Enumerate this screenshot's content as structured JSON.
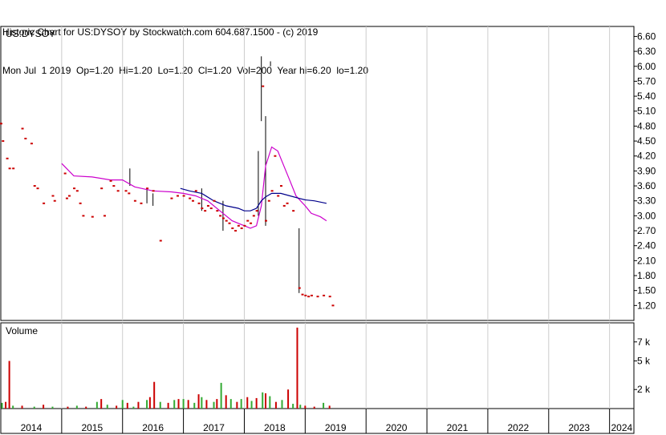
{
  "header": {
    "line1": "Historic Chart for US:DYSOY by Stockwatch.com 604.687.1500 - (c) 2019",
    "line2": "Mon Jul  1 2019  Op=1.20  Hi=1.20  Lo=1.20  Cl=1.20  Vol=200  Year hi=6.20  lo=1.20"
  },
  "colors": {
    "ma_short": "#cc00cc",
    "ma_long": "#00008b",
    "price": "#cc0000",
    "vol_up": "#33aa33",
    "vol_down": "#cc0000"
  },
  "chart_data": {
    "type": "line",
    "title": "US:DYSOY",
    "price_axis": {
      "ylim": [
        0.9,
        6.8
      ],
      "ticks": [
        "6.60",
        "6.30",
        "6.00",
        "5.70",
        "5.40",
        "5.10",
        "4.80",
        "4.50",
        "4.20",
        "3.90",
        "3.60",
        "3.30",
        "3.00",
        "2.70",
        "2.40",
        "2.10",
        "1.80",
        "1.50",
        "1.20"
      ]
    },
    "volume_panel": {
      "label": "Volume",
      "ylim": [
        0,
        9000
      ],
      "ticks": [
        {
          "v": 7000,
          "label": "7 k"
        },
        {
          "v": 5000,
          "label": "5 k"
        },
        {
          "v": 2000,
          "label": "2 k"
        }
      ]
    },
    "x_axis": {
      "years": [
        "2014",
        "2015",
        "2016",
        "2017",
        "2018",
        "2019",
        "2020",
        "2021",
        "2022",
        "2023",
        "2024"
      ],
      "xlim": [
        2014.0,
        2024.4
      ]
    },
    "price_points": [
      [
        2014.0,
        4.85
      ],
      [
        2014.03,
        4.5
      ],
      [
        2014.1,
        4.15
      ],
      [
        2014.14,
        3.95
      ],
      [
        2014.2,
        3.95
      ],
      [
        2014.35,
        4.75
      ],
      [
        2014.4,
        4.55
      ],
      [
        2014.5,
        4.45
      ],
      [
        2014.55,
        3.6
      ],
      [
        2014.6,
        3.55
      ],
      [
        2014.7,
        3.25
      ],
      [
        2014.85,
        3.4
      ],
      [
        2014.88,
        3.3
      ],
      [
        2015.05,
        3.85
      ],
      [
        2015.08,
        3.35
      ],
      [
        2015.12,
        3.4
      ],
      [
        2015.2,
        3.55
      ],
      [
        2015.25,
        3.5
      ],
      [
        2015.3,
        3.25
      ],
      [
        2015.35,
        3.0
      ],
      [
        2015.5,
        2.98
      ],
      [
        2015.65,
        3.55
      ],
      [
        2015.7,
        3.0
      ],
      [
        2015.8,
        3.7
      ],
      [
        2015.85,
        3.6
      ],
      [
        2015.92,
        3.5
      ],
      [
        2016.05,
        3.5
      ],
      [
        2016.1,
        3.45
      ],
      [
        2016.2,
        3.3
      ],
      [
        2016.3,
        3.25
      ],
      [
        2016.4,
        3.55
      ],
      [
        2016.5,
        3.5
      ],
      [
        2016.62,
        2.5
      ],
      [
        2016.8,
        3.35
      ],
      [
        2016.9,
        3.4
      ],
      [
        2017.0,
        3.4
      ],
      [
        2017.1,
        3.35
      ],
      [
        2017.15,
        3.3
      ],
      [
        2017.2,
        3.5
      ],
      [
        2017.25,
        3.25
      ],
      [
        2017.3,
        3.15
      ],
      [
        2017.35,
        3.1
      ],
      [
        2017.4,
        3.2
      ],
      [
        2017.45,
        3.15
      ],
      [
        2017.5,
        3.3
      ],
      [
        2017.55,
        3.1
      ],
      [
        2017.6,
        3.0
      ],
      [
        2017.65,
        2.95
      ],
      [
        2017.7,
        2.9
      ],
      [
        2017.75,
        2.85
      ],
      [
        2017.8,
        2.75
      ],
      [
        2017.85,
        2.7
      ],
      [
        2017.9,
        2.8
      ],
      [
        2017.95,
        2.75
      ],
      [
        2018.0,
        2.8
      ],
      [
        2018.05,
        2.9
      ],
      [
        2018.1,
        2.85
      ],
      [
        2018.15,
        3.0
      ],
      [
        2018.2,
        3.1
      ],
      [
        2018.3,
        5.6
      ],
      [
        2018.35,
        2.9
      ],
      [
        2018.4,
        3.3
      ],
      [
        2018.45,
        3.5
      ],
      [
        2018.5,
        4.2
      ],
      [
        2018.55,
        3.4
      ],
      [
        2018.6,
        3.6
      ],
      [
        2018.65,
        3.2
      ],
      [
        2018.7,
        3.25
      ],
      [
        2018.8,
        3.1
      ],
      [
        2018.9,
        1.55
      ],
      [
        2018.95,
        1.42
      ],
      [
        2019.0,
        1.4
      ],
      [
        2019.05,
        1.38
      ],
      [
        2019.1,
        1.4
      ],
      [
        2019.2,
        1.38
      ],
      [
        2019.3,
        1.4
      ],
      [
        2019.4,
        1.38
      ],
      [
        2019.45,
        1.2
      ]
    ],
    "price_spikes": [
      {
        "x": 2016.12,
        "lo": 3.6,
        "hi": 3.95
      },
      {
        "x": 2016.4,
        "lo": 3.25,
        "hi": 3.55
      },
      {
        "x": 2016.5,
        "lo": 3.2,
        "hi": 3.45
      },
      {
        "x": 2017.3,
        "lo": 3.1,
        "hi": 3.55
      },
      {
        "x": 2017.65,
        "lo": 2.7,
        "hi": 3.3
      },
      {
        "x": 2018.23,
        "lo": 3.0,
        "hi": 4.3
      },
      {
        "x": 2018.28,
        "lo": 4.9,
        "hi": 6.2
      },
      {
        "x": 2018.35,
        "lo": 2.8,
        "hi": 5.0
      },
      {
        "x": 2018.43,
        "lo": 6.0,
        "hi": 6.1
      },
      {
        "x": 2018.9,
        "lo": 1.45,
        "hi": 2.75
      }
    ],
    "series": [
      {
        "values": [
          [
            2015.0,
            4.05
          ],
          [
            2015.2,
            3.8
          ],
          [
            2015.5,
            3.78
          ],
          [
            2015.8,
            3.72
          ],
          [
            2016.0,
            3.72
          ],
          [
            2016.2,
            3.58
          ],
          [
            2016.5,
            3.5
          ],
          [
            2016.8,
            3.48
          ],
          [
            2017.0,
            3.45
          ],
          [
            2017.2,
            3.4
          ],
          [
            2017.4,
            3.3
          ],
          [
            2017.6,
            3.1
          ],
          [
            2017.8,
            2.9
          ],
          [
            2018.0,
            2.8
          ],
          [
            2018.1,
            2.75
          ],
          [
            2018.2,
            2.8
          ],
          [
            2018.28,
            3.2
          ],
          [
            2018.35,
            4.0
          ],
          [
            2018.45,
            4.38
          ],
          [
            2018.55,
            4.3
          ],
          [
            2018.65,
            4.0
          ],
          [
            2018.75,
            3.7
          ],
          [
            2018.85,
            3.4
          ],
          [
            2019.0,
            3.2
          ],
          [
            2019.1,
            3.05
          ],
          [
            2019.25,
            2.98
          ],
          [
            2019.35,
            2.9
          ]
        ]
      },
      {
        "values": [
          [
            2016.95,
            3.55
          ],
          [
            2017.1,
            3.5
          ],
          [
            2017.3,
            3.45
          ],
          [
            2017.5,
            3.3
          ],
          [
            2017.7,
            3.2
          ],
          [
            2017.9,
            3.15
          ],
          [
            2018.0,
            3.1
          ],
          [
            2018.1,
            3.1
          ],
          [
            2018.2,
            3.15
          ],
          [
            2018.28,
            3.3
          ],
          [
            2018.35,
            3.38
          ],
          [
            2018.45,
            3.45
          ],
          [
            2018.6,
            3.45
          ],
          [
            2018.75,
            3.4
          ],
          [
            2018.9,
            3.35
          ],
          [
            2019.0,
            3.32
          ],
          [
            2019.15,
            3.3
          ],
          [
            2019.35,
            3.25
          ]
        ]
      }
    ],
    "volume_bars": [
      [
        2014.02,
        600,
        "up"
      ],
      [
        2014.08,
        700,
        "down"
      ],
      [
        2014.14,
        5000,
        "down"
      ],
      [
        2014.2,
        300,
        "up"
      ],
      [
        2014.35,
        300,
        "down"
      ],
      [
        2014.55,
        200,
        "up"
      ],
      [
        2014.7,
        400,
        "down"
      ],
      [
        2014.85,
        200,
        "up"
      ],
      [
        2015.1,
        200,
        "down"
      ],
      [
        2015.25,
        300,
        "up"
      ],
      [
        2015.4,
        200,
        "down"
      ],
      [
        2015.58,
        700,
        "up"
      ],
      [
        2015.65,
        1000,
        "down"
      ],
      [
        2015.75,
        400,
        "up"
      ],
      [
        2015.9,
        300,
        "down"
      ],
      [
        2016.0,
        900,
        "up"
      ],
      [
        2016.08,
        600,
        "down"
      ],
      [
        2016.18,
        200,
        "up"
      ],
      [
        2016.26,
        700,
        "down"
      ],
      [
        2016.4,
        900,
        "up"
      ],
      [
        2016.45,
        1200,
        "down"
      ],
      [
        2016.52,
        2800,
        "down"
      ],
      [
        2016.62,
        700,
        "up"
      ],
      [
        2016.75,
        600,
        "down"
      ],
      [
        2016.85,
        900,
        "up"
      ],
      [
        2016.92,
        1000,
        "down"
      ],
      [
        2017.0,
        1000,
        "up"
      ],
      [
        2017.08,
        900,
        "down"
      ],
      [
        2017.18,
        600,
        "up"
      ],
      [
        2017.25,
        1500,
        "down"
      ],
      [
        2017.3,
        1200,
        "up"
      ],
      [
        2017.38,
        900,
        "down"
      ],
      [
        2017.5,
        700,
        "up"
      ],
      [
        2017.55,
        1000,
        "down"
      ],
      [
        2017.62,
        2700,
        "up"
      ],
      [
        2017.7,
        1400,
        "down"
      ],
      [
        2017.78,
        1000,
        "up"
      ],
      [
        2017.88,
        700,
        "down"
      ],
      [
        2017.95,
        1000,
        "up"
      ],
      [
        2018.05,
        1200,
        "down"
      ],
      [
        2018.12,
        800,
        "up"
      ],
      [
        2018.2,
        1100,
        "down"
      ],
      [
        2018.3,
        1700,
        "up"
      ],
      [
        2018.35,
        1600,
        "down"
      ],
      [
        2018.42,
        1300,
        "up"
      ],
      [
        2018.52,
        700,
        "down"
      ],
      [
        2018.62,
        900,
        "up"
      ],
      [
        2018.72,
        2000,
        "down"
      ],
      [
        2018.8,
        500,
        "up"
      ],
      [
        2018.87,
        8500,
        "down"
      ],
      [
        2018.92,
        400,
        "up"
      ],
      [
        2019.0,
        300,
        "down"
      ],
      [
        2019.15,
        200,
        "down"
      ],
      [
        2019.3,
        600,
        "up"
      ],
      [
        2019.4,
        300,
        "down"
      ]
    ]
  }
}
